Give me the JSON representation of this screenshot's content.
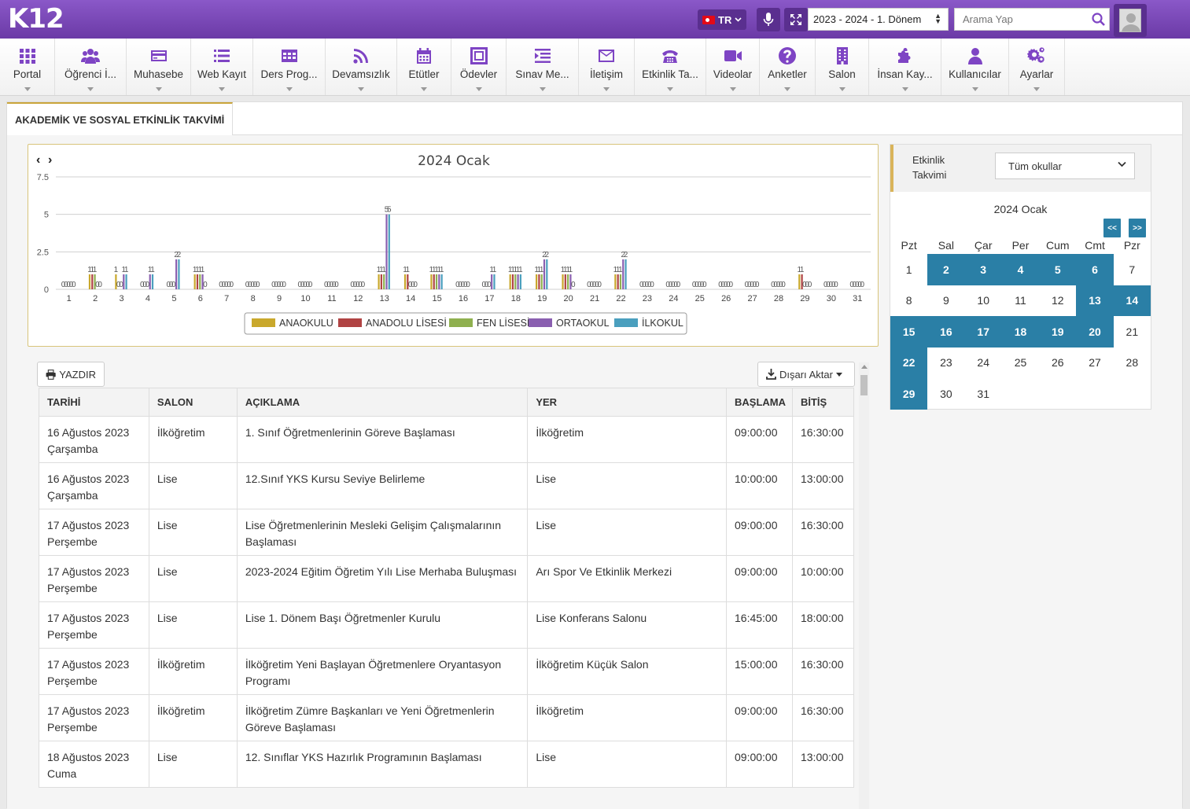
{
  "app": {
    "logo": "K12",
    "lang": "TR",
    "term_select": "2023 - 2024 - 1. Dönem",
    "search_placeholder": "Arama Yap"
  },
  "nav": [
    {
      "label": "Portal",
      "icon": "grid-icon"
    },
    {
      "label": "Öğrenci İ...",
      "icon": "users-icon"
    },
    {
      "label": "Muhasebe",
      "icon": "credit-card-icon"
    },
    {
      "label": "Web Kayıt",
      "icon": "list-icon"
    },
    {
      "label": "Ders Prog...",
      "icon": "table-icon"
    },
    {
      "label": "Devamsızlık",
      "icon": "rss-icon"
    },
    {
      "label": "Etütler",
      "icon": "calendar-icon"
    },
    {
      "label": "Ödevler",
      "icon": "frame-icon"
    },
    {
      "label": "Sınav Me...",
      "icon": "indent-list-icon"
    },
    {
      "label": "İletişim",
      "icon": "envelope-icon"
    },
    {
      "label": "Etkinlik Ta...",
      "icon": "phone-icon"
    },
    {
      "label": "Videolar",
      "icon": "video-camera-icon"
    },
    {
      "label": "Anketler",
      "icon": "question-icon"
    },
    {
      "label": "Salon",
      "icon": "building-icon"
    },
    {
      "label": "İnsan Kay...",
      "icon": "puzzle-icon"
    },
    {
      "label": "Kullanıcılar",
      "icon": "user-icon"
    },
    {
      "label": "Ayarlar",
      "icon": "gears-icon"
    }
  ],
  "page": {
    "tab_title": "AKADEMİK VE SOSYAL ETKİNLİK TAKVİMİ"
  },
  "chart_data": {
    "type": "bar",
    "title": "2024 Ocak",
    "categories": [
      "1",
      "2",
      "3",
      "4",
      "5",
      "6",
      "7",
      "8",
      "9",
      "10",
      "11",
      "12",
      "13",
      "14",
      "15",
      "16",
      "17",
      "18",
      "19",
      "20",
      "21",
      "22",
      "23",
      "24",
      "25",
      "26",
      "27",
      "28",
      "29",
      "30",
      "31"
    ],
    "ylim": [
      0,
      7.5
    ],
    "yticks": [
      "0",
      "2.5",
      "5",
      "7.5"
    ],
    "legend_position": "bottom",
    "series": [
      {
        "name": "ANAOKULU",
        "color": "#c9a82c",
        "values": [
          0,
          1,
          1,
          0,
          0,
          1,
          0,
          0,
          0,
          0,
          0,
          0,
          1,
          1,
          1,
          0,
          0,
          1,
          1,
          1,
          0,
          1,
          0,
          0,
          0,
          0,
          0,
          0,
          1,
          0,
          0
        ]
      },
      {
        "name": "ANADOLU LİSESİ",
        "color": "#b04343",
        "values": [
          0,
          1,
          0,
          0,
          0,
          1,
          0,
          0,
          0,
          0,
          0,
          0,
          1,
          1,
          1,
          0,
          0,
          1,
          1,
          1,
          0,
          1,
          0,
          0,
          0,
          0,
          0,
          0,
          1,
          0,
          0
        ]
      },
      {
        "name": "FEN LİSESİ",
        "color": "#8fb04f",
        "values": [
          0,
          1,
          0,
          0,
          0,
          1,
          0,
          0,
          0,
          0,
          0,
          0,
          1,
          0,
          1,
          0,
          0,
          1,
          1,
          1,
          0,
          1,
          0,
          0,
          0,
          0,
          0,
          0,
          0,
          0,
          0
        ]
      },
      {
        "name": "ORTAOKUL",
        "color": "#8a5fb0",
        "values": [
          0,
          0,
          1,
          1,
          2,
          1,
          0,
          0,
          0,
          0,
          0,
          0,
          5,
          0,
          1,
          0,
          1,
          1,
          2,
          1,
          0,
          2,
          0,
          0,
          0,
          0,
          0,
          0,
          0,
          0,
          0
        ]
      },
      {
        "name": "İLKOKUL",
        "color": "#4a9fbe",
        "values": [
          0,
          0,
          1,
          1,
          2,
          0,
          0,
          0,
          0,
          0,
          0,
          0,
          5,
          0,
          1,
          0,
          1,
          1,
          2,
          0,
          0,
          2,
          0,
          0,
          0,
          0,
          0,
          0,
          0,
          0,
          0
        ]
      }
    ]
  },
  "calendar": {
    "header_label": "Etkinlik Takvimi",
    "school_select": "Tüm okullar",
    "month_title": "2024 Ocak",
    "prev_label": "<<",
    "next_label": ">>",
    "dow": [
      "Pzt",
      "Sal",
      "Çar",
      "Per",
      "Cum",
      "Cmt",
      "Pzr"
    ],
    "weeks": [
      [
        {
          "d": "1",
          "ev": false
        },
        {
          "d": "2",
          "ev": true
        },
        {
          "d": "3",
          "ev": true
        },
        {
          "d": "4",
          "ev": true
        },
        {
          "d": "5",
          "ev": true
        },
        {
          "d": "6",
          "ev": true
        },
        {
          "d": "7",
          "ev": false
        }
      ],
      [
        {
          "d": "8",
          "ev": false
        },
        {
          "d": "9",
          "ev": false
        },
        {
          "d": "10",
          "ev": false
        },
        {
          "d": "11",
          "ev": false
        },
        {
          "d": "12",
          "ev": false
        },
        {
          "d": "13",
          "ev": true
        },
        {
          "d": "14",
          "ev": true
        }
      ],
      [
        {
          "d": "15",
          "ev": true
        },
        {
          "d": "16",
          "ev": true
        },
        {
          "d": "17",
          "ev": true
        },
        {
          "d": "18",
          "ev": true
        },
        {
          "d": "19",
          "ev": true
        },
        {
          "d": "20",
          "ev": true
        },
        {
          "d": "21",
          "ev": false
        }
      ],
      [
        {
          "d": "22",
          "ev": true
        },
        {
          "d": "23",
          "ev": false
        },
        {
          "d": "24",
          "ev": false
        },
        {
          "d": "25",
          "ev": false
        },
        {
          "d": "26",
          "ev": false
        },
        {
          "d": "27",
          "ev": false
        },
        {
          "d": "28",
          "ev": false
        }
      ],
      [
        {
          "d": "29",
          "ev": true
        },
        {
          "d": "30",
          "ev": false
        },
        {
          "d": "31",
          "ev": false
        },
        {
          "d": "",
          "ev": false
        },
        {
          "d": "",
          "ev": false
        },
        {
          "d": "",
          "ev": false
        },
        {
          "d": "",
          "ev": false
        }
      ]
    ]
  },
  "table": {
    "print_label": "YAZDIR",
    "export_label": "Dışarı Aktar",
    "columns": [
      "TARİHİ",
      "SALON",
      "AÇIKLAMA",
      "YER",
      "BAŞLAMA",
      "BİTİŞ"
    ],
    "rows": [
      {
        "date": "16 Ağustos 2023",
        "day": "Çarşamba",
        "salon": "İlköğretim",
        "desc": "1. Sınıf Öğretmenlerinin Göreve Başlaması",
        "place": "İlköğretim",
        "start": "09:00:00",
        "end": "16:30:00"
      },
      {
        "date": "16 Ağustos 2023",
        "day": "Çarşamba",
        "salon": "Lise",
        "desc": "12.Sınıf YKS Kursu Seviye Belirleme",
        "place": "Lise",
        "start": "10:00:00",
        "end": "13:00:00"
      },
      {
        "date": "17 Ağustos 2023",
        "day": "Perşembe",
        "salon": "Lise",
        "desc": "Lise Öğretmenlerinin Mesleki Gelişim Çalışmalarının Başlaması",
        "place": "Lise",
        "start": "09:00:00",
        "end": "16:30:00"
      },
      {
        "date": "17 Ağustos 2023",
        "day": "Perşembe",
        "salon": "Lise",
        "desc": "2023-2024 Eğitim Öğretim Yılı Lise Merhaba Buluşması",
        "place": "Arı Spor Ve Etkinlik Merkezi",
        "start": "09:00:00",
        "end": "10:00:00"
      },
      {
        "date": "17 Ağustos 2023",
        "day": "Perşembe",
        "salon": "Lise",
        "desc": "Lise 1. Dönem Başı Öğretmenler Kurulu",
        "place": "Lise Konferans Salonu",
        "start": "16:45:00",
        "end": "18:00:00"
      },
      {
        "date": "17 Ağustos 2023",
        "day": "Perşembe",
        "salon": "İlköğretim",
        "desc": "İlköğretim Yeni Başlayan Öğretmenlere Oryantasyon Programı",
        "place": "İlköğretim Küçük Salon",
        "start": "15:00:00",
        "end": "16:30:00"
      },
      {
        "date": "17 Ağustos 2023",
        "day": "Perşembe",
        "salon": "İlköğretim",
        "desc": "İlköğretim Zümre Başkanları ve Yeni Öğretmenlerin Göreve Başlaması",
        "place": "İlköğretim",
        "start": "09:00:00",
        "end": "16:30:00"
      },
      {
        "date": "18 Ağustos 2023",
        "day": "Cuma",
        "salon": "Lise",
        "desc": "12. Sınıflar YKS Hazırlık Programının Başlaması",
        "place": "Lise",
        "start": "09:00:00",
        "end": "13:00:00"
      }
    ]
  }
}
